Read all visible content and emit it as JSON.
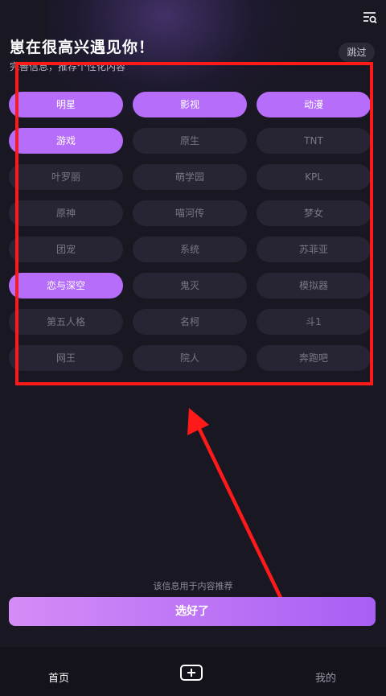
{
  "header": {
    "title": "崽在很高兴遇见你！",
    "subtitle": "完善信息，推荐个性化内容",
    "skip_label": "跳过",
    "menu_icon": "search-list-icon"
  },
  "tags": [
    {
      "label": "明星",
      "selected": true
    },
    {
      "label": "影视",
      "selected": true
    },
    {
      "label": "动漫",
      "selected": true
    },
    {
      "label": "游戏",
      "selected": true
    },
    {
      "label": "原生",
      "selected": false
    },
    {
      "label": "TNT",
      "selected": false
    },
    {
      "label": "叶罗丽",
      "selected": false
    },
    {
      "label": "萌学园",
      "selected": false
    },
    {
      "label": "KPL",
      "selected": false
    },
    {
      "label": "原神",
      "selected": false
    },
    {
      "label": "喵河传",
      "selected": false
    },
    {
      "label": "梦女",
      "selected": false
    },
    {
      "label": "团宠",
      "selected": false
    },
    {
      "label": "系统",
      "selected": false
    },
    {
      "label": "苏菲亚",
      "selected": false
    },
    {
      "label": "恋与深空",
      "selected": true
    },
    {
      "label": "鬼灭",
      "selected": false
    },
    {
      "label": "模拟器",
      "selected": false
    },
    {
      "label": "第五人格",
      "selected": false
    },
    {
      "label": "名柯",
      "selected": false
    },
    {
      "label": "斗1",
      "selected": false
    },
    {
      "label": "网王",
      "selected": false
    },
    {
      "label": "院人",
      "selected": false
    },
    {
      "label": "奔跑吧",
      "selected": false
    }
  ],
  "footer": {
    "note": "该信息用于内容推荐",
    "confirm_label": "选好了"
  },
  "bottom_nav": {
    "home_label": "首页",
    "add_icon": "add-icon",
    "mine_label": "我的"
  },
  "colors": {
    "accent": "#b56dfa",
    "tag_bg": "#272533",
    "page_bg": "#191722",
    "annotation": "#ff1a1a"
  }
}
